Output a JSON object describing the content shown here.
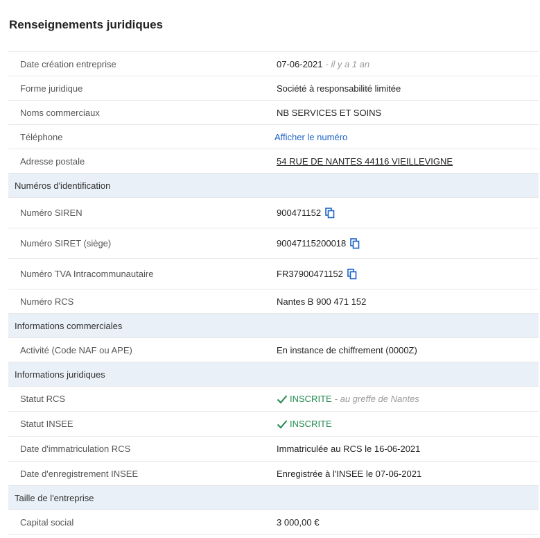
{
  "title": "Renseignements juridiques",
  "general": {
    "creation_label": "Date création entreprise",
    "creation_value": "07-06-2021",
    "creation_hint": "- il y a 1 an",
    "forme_label": "Forme juridique",
    "forme_value": "Société à responsabilité limitée",
    "noms_label": "Noms commerciaux",
    "noms_value": "NB SERVICES ET SOINS",
    "tel_label": "Téléphone",
    "tel_value": "Afficher le numéro",
    "adresse_label": "Adresse postale",
    "adresse_value": "54 RUE DE NANTES 44116 VIEILLEVIGNE"
  },
  "identification": {
    "section": "Numéros d'identification",
    "siren_label": "Numéro SIREN",
    "siren_value": "900471152",
    "siret_label": "Numéro SIRET (siège)",
    "siret_value": "90047115200018",
    "tva_label": "Numéro TVA Intracommunautaire",
    "tva_value": "FR37900471152",
    "rcs_label": "Numéro RCS",
    "rcs_value": "Nantes B 900 471 152"
  },
  "commercial": {
    "section": "Informations commerciales",
    "activite_label": "Activité (Code NAF ou APE)",
    "activite_value": "En instance de chiffrement (0000Z)"
  },
  "juridique": {
    "section": "Informations juridiques",
    "statut_rcs_label": "Statut RCS",
    "statut_rcs_value": "INSCRITE",
    "statut_rcs_hint": "- au greffe de Nantes",
    "statut_insee_label": "Statut INSEE",
    "statut_insee_value": "INSCRITE",
    "immat_label": "Date d'immatriculation RCS",
    "immat_value": "Immatriculée au RCS le 16-06-2021",
    "enreg_label": "Date d'enregistrement INSEE",
    "enreg_value": "Enregistrée à l'INSEE le 07-06-2021"
  },
  "taille": {
    "section": "Taille de l'entreprise",
    "capital_label": "Capital social",
    "capital_value": "3 000,00 €"
  },
  "colors": {
    "link": "#1a62c7",
    "success": "#1f8a4c",
    "section_bg": "#e9f0f7"
  }
}
